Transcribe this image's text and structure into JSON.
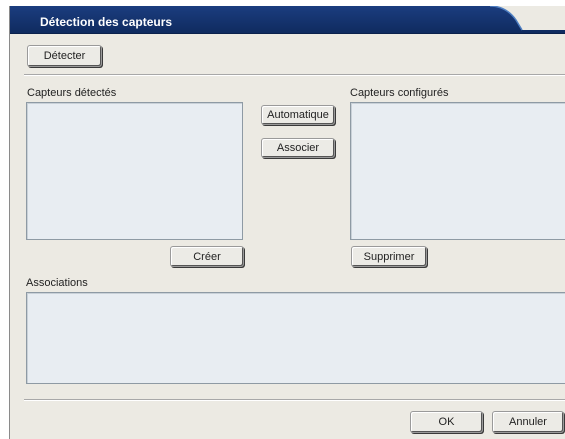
{
  "window": {
    "title": "Détection des capteurs"
  },
  "toolbar": {
    "detect_label": "Détecter"
  },
  "detected": {
    "label": "Capteurs détectés",
    "items": []
  },
  "configured": {
    "label": "Capteurs configurés",
    "items": []
  },
  "actions": {
    "automatic_label": "Automatique",
    "associate_label": "Associer",
    "create_label": "Créer",
    "delete_label": "Supprimer"
  },
  "associations": {
    "label": "Associations",
    "items": []
  },
  "footer": {
    "ok_label": "OK",
    "cancel_label": "Annuler"
  },
  "colors": {
    "titlebar": "#12306b",
    "titlebar_highlight": "#3d6fb5",
    "dialog_bg": "#eceae3",
    "listbox_bg": "#e8edf2"
  }
}
